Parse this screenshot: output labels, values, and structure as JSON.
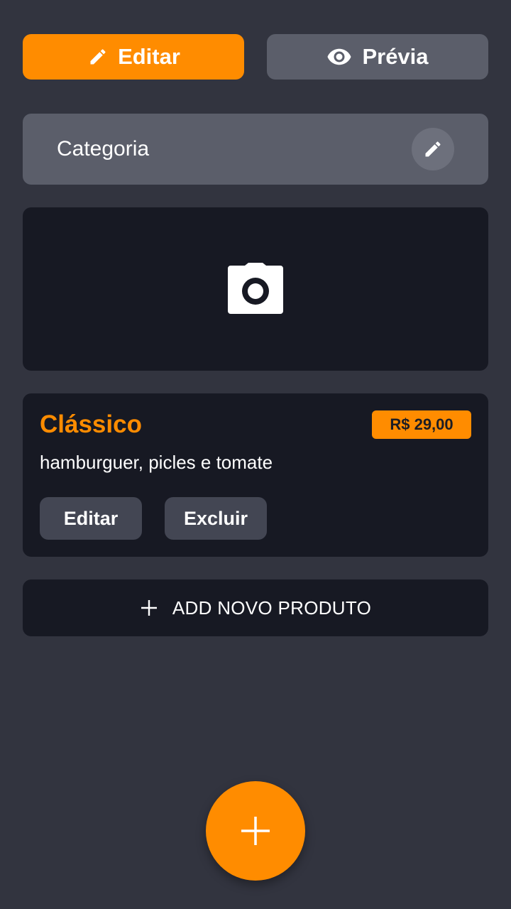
{
  "mode_toggle": {
    "edit_label": "Editar",
    "edit_icon": "pencil-icon",
    "preview_label": "Prévia",
    "preview_icon": "eye-icon"
  },
  "category": {
    "label": "Categoria",
    "edit_icon": "pencil-icon"
  },
  "image_placeholder": {
    "icon": "camera-icon"
  },
  "product": {
    "name": "Clássico",
    "price": "R$ 29,00",
    "description": "hamburguer, picles e tomate",
    "edit_label": "Editar",
    "delete_label": "Excluir"
  },
  "add_product": {
    "label": "ADD NOVO PRODUTO",
    "icon": "plus-icon"
  },
  "fab": {
    "icon": "plus-icon"
  },
  "colors": {
    "background": "#32343f",
    "accent": "#ff8c00",
    "card": "#171923",
    "secondary": "#5b5e6a"
  }
}
